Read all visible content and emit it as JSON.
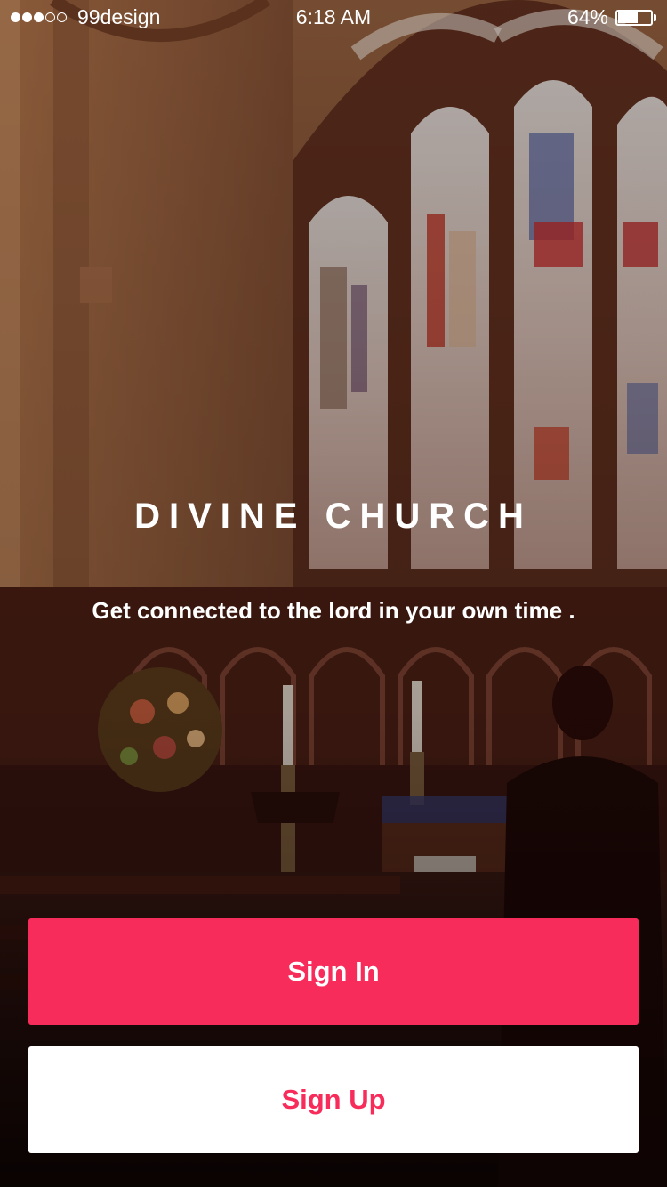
{
  "status_bar": {
    "signal_dots_filled": 3,
    "signal_dots_total": 5,
    "carrier": "99design",
    "time": "6:18 AM",
    "battery_percent_label": "64%",
    "battery_level": 0.64
  },
  "hero": {
    "title": "DIVINE CHURCH",
    "tagline": "Get connected to the lord in your own time ."
  },
  "actions": {
    "sign_in_label": "Sign In",
    "sign_up_label": "Sign Up"
  },
  "colors": {
    "accent": "#f72c5b",
    "text_light": "#ffffff",
    "background_dark": "#2a100c"
  },
  "icons": {
    "signal": "signal-dots-icon",
    "battery": "battery-icon"
  }
}
